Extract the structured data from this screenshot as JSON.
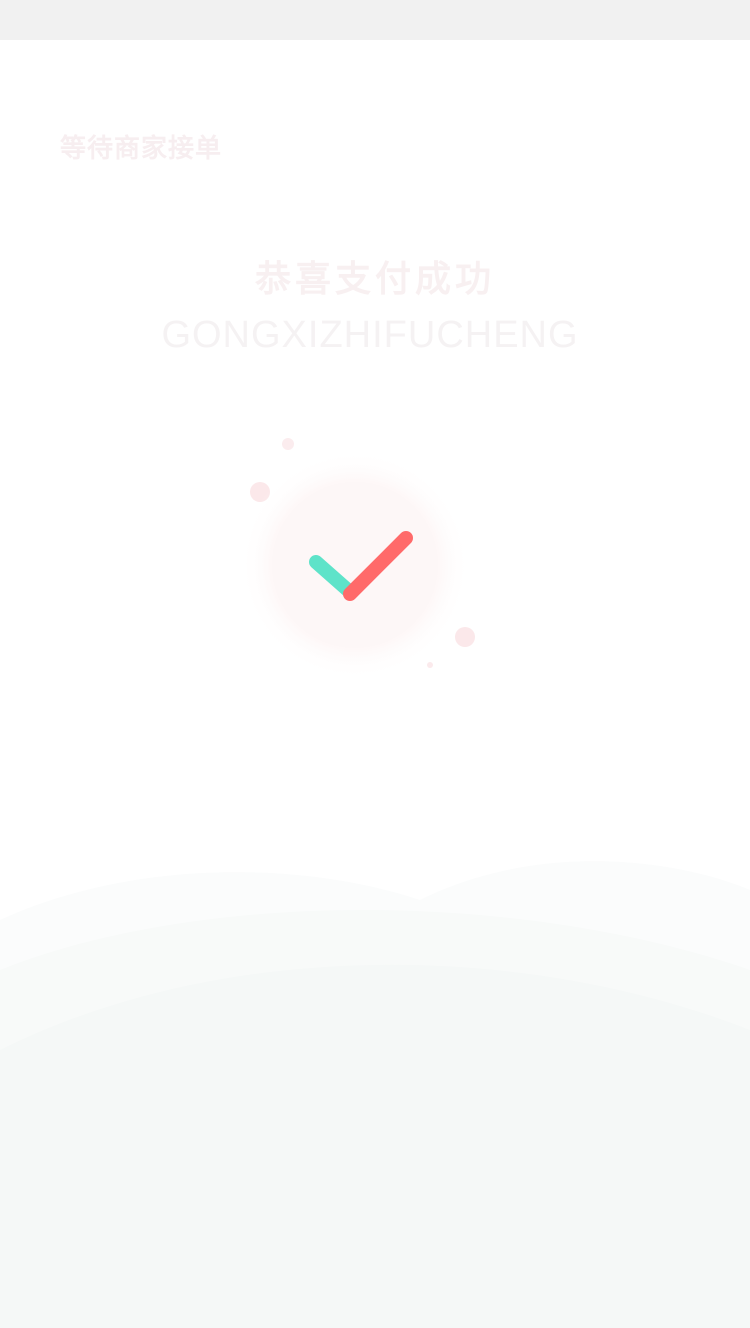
{
  "header": {
    "status_text": "等待商家接单"
  },
  "success": {
    "title_cn": "恭喜支付成功",
    "title_pinyin": "GONGXIZHIFUCHENG",
    "icon": "check-icon"
  },
  "colors": {
    "check_short": "#5ee3c9",
    "check_long": "#ff6a6a",
    "circle_bg": "#fdf7f7",
    "wave": "#f5f8f7"
  }
}
